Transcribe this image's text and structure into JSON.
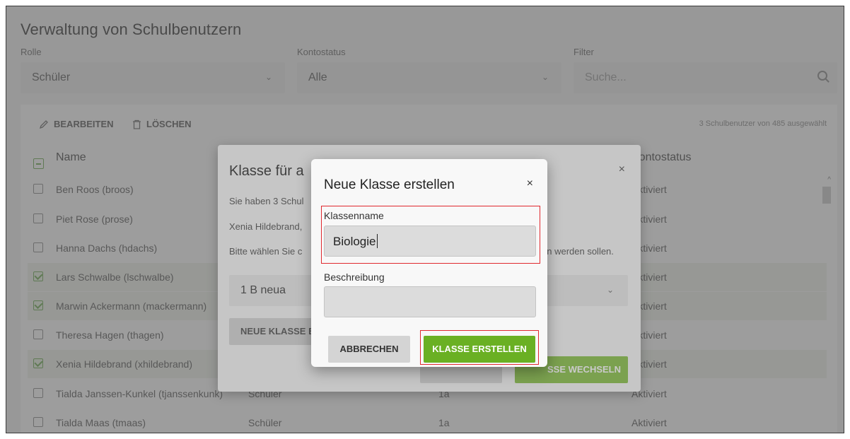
{
  "page": {
    "title": "Verwaltung von Schulbenutzern",
    "filters": {
      "role_label": "Rolle",
      "role_value": "Schüler",
      "status_label": "Kontostatus",
      "status_value": "Alle",
      "filter_label": "Filter",
      "search_placeholder": "Suche..."
    },
    "toolbar": {
      "edit_label": "BEARBEITEN",
      "delete_label": "LÖSCHEN",
      "selected_count": "3 Schulbenutzer von 485 ausgewählt"
    },
    "table": {
      "headers": [
        "Name",
        "Kontostatus"
      ],
      "rows": [
        {
          "name": "Ben Roos (broos)",
          "role": "",
          "class": "",
          "status": "Aktiviert",
          "selected": false
        },
        {
          "name": "Piet Rose (prose)",
          "role": "",
          "class": "",
          "status": "Aktiviert",
          "selected": false
        },
        {
          "name": "Hanna Dachs (hdachs)",
          "role": "",
          "class": "",
          "status": "Aktiviert",
          "selected": false
        },
        {
          "name": "Lars Schwalbe (lschwalbe)",
          "role": "",
          "class": "",
          "status": "Aktiviert",
          "selected": true
        },
        {
          "name": "Marwin Ackermann (mackermann)",
          "role": "",
          "class": "",
          "status": "Aktiviert",
          "selected": true
        },
        {
          "name": "Theresa Hagen (thagen)",
          "role": "",
          "class": "",
          "status": "Aktiviert",
          "selected": false
        },
        {
          "name": "Xenia Hildebrand (xhildebrand)",
          "role": "",
          "class": "",
          "status": "Aktiviert",
          "selected": true
        },
        {
          "name": "Tialda Janssen-Kunkel (tjanssenkunk)",
          "role": "Schüler",
          "class": "1a",
          "status": "Aktiviert",
          "selected": false
        },
        {
          "name": "Tialda Maas (tmaas)",
          "role": "Schüler",
          "class": "1a",
          "status": "Aktiviert",
          "selected": false
        }
      ]
    }
  },
  "dialog_assign": {
    "title": "Klasse für a",
    "text_1": "Sie haben 3 Schul",
    "text_2": "Xenia Hildebrand,",
    "text_3": "Bitte wählen Sie c",
    "text_3_end": "en werden sollen.",
    "class_select_value": "1 B neua",
    "new_class_button": "NEUE KLASSE E",
    "switch_button": "SSE WECHSELN"
  },
  "dialog_new_class": {
    "title": "Neue Klasse erstellen",
    "name_label": "Klassenname",
    "name_value": "Biologie",
    "description_label": "Beschreibung",
    "description_value": "",
    "cancel_label": "ABBRECHEN",
    "create_label": "KLASSE ERSTELLEN"
  },
  "colors": {
    "accent_green": "#6ab023",
    "highlight_red": "#e0282e"
  },
  "icons": {
    "close": "×",
    "chevron": "⌄"
  }
}
